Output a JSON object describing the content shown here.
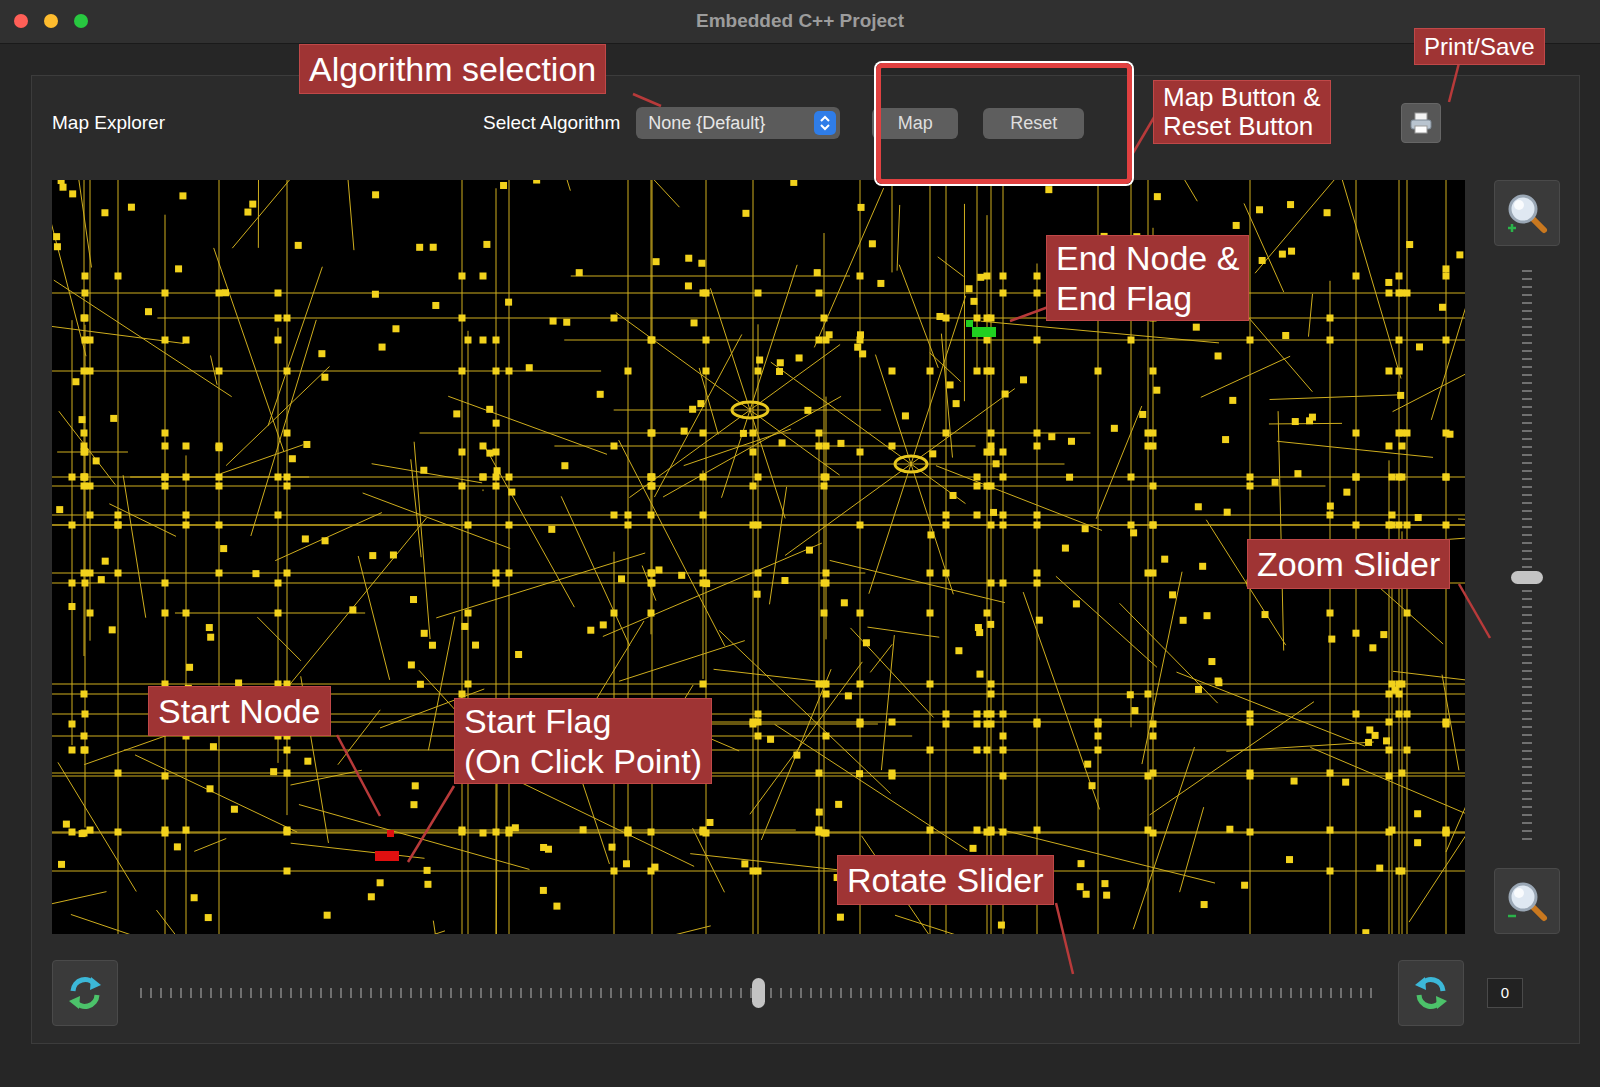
{
  "window": {
    "title": "Embedded C++ Project"
  },
  "header": {
    "label": "Map Explorer",
    "algorithm": {
      "label": "Select Algorithm",
      "value": "None {Default}"
    },
    "buttons": [
      "Map",
      "Reset"
    ]
  },
  "map": {
    "markers": [
      {
        "name": "start-node",
        "color": "#e01010"
      },
      {
        "name": "start-flag",
        "color": "#e01010"
      },
      {
        "name": "end-node",
        "color": "#20d020"
      },
      {
        "name": "end-flag",
        "color": "#20d020"
      }
    ]
  },
  "zoom_slider": {
    "level": 0.46
  },
  "rotate_slider": {
    "level": 0.5,
    "reading": "0"
  },
  "annotations": [
    {
      "lines": [
        "Algorithm selection"
      ]
    },
    {
      "lines": [
        "Map Button &",
        "Reset Button"
      ]
    },
    {
      "lines": [
        "Print/Save"
      ]
    },
    {
      "lines": [
        "End Node &",
        "End Flag"
      ]
    },
    {
      "lines": [
        "Zoom Slider"
      ]
    },
    {
      "lines": [
        "Start Node"
      ]
    },
    {
      "lines": [
        "Start Flag",
        "(On Click Point)"
      ]
    },
    {
      "lines": [
        "Rotate Slider"
      ]
    }
  ]
}
